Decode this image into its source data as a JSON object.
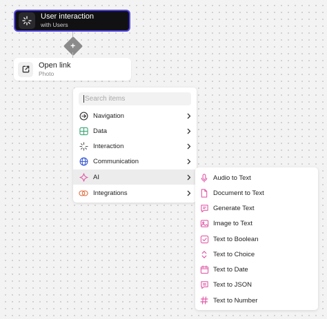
{
  "trigger_node": {
    "title": "User interaction",
    "subtitle": "with Users"
  },
  "action_node": {
    "title": "Open link",
    "subtitle": "Photo"
  },
  "add_button": {
    "symbol": "+"
  },
  "search": {
    "placeholder": "Search items"
  },
  "menu": {
    "items": [
      {
        "label": "Navigation",
        "icon": "navigation-icon",
        "color": "#333333"
      },
      {
        "label": "Data",
        "icon": "data-table-icon",
        "color": "#3aa673"
      },
      {
        "label": "Interaction",
        "icon": "interaction-icon",
        "color": "#555555"
      },
      {
        "label": "Communication",
        "icon": "globe-icon",
        "color": "#3b5bd6"
      },
      {
        "label": "AI",
        "icon": "ai-sparkle-icon",
        "color": "#e05aa8"
      },
      {
        "label": "Integrations",
        "icon": "integrations-icon",
        "color": "#e06a3a"
      }
    ]
  },
  "submenu": {
    "accent_color": "#e05aa8",
    "items": [
      {
        "label": "Audio to Text",
        "icon": "microphone-icon"
      },
      {
        "label": "Document to Text",
        "icon": "document-icon"
      },
      {
        "label": "Generate Text",
        "icon": "chat-bubble-icon"
      },
      {
        "label": "Image to Text",
        "icon": "image-icon"
      },
      {
        "label": "Text to Boolean",
        "icon": "checkbox-icon"
      },
      {
        "label": "Text to Choice",
        "icon": "up-down-arrows-icon"
      },
      {
        "label": "Text to Date",
        "icon": "calendar-icon"
      },
      {
        "label": "Text to JSON",
        "icon": "json-bubble-icon"
      },
      {
        "label": "Text to Number",
        "icon": "hash-icon"
      }
    ]
  }
}
